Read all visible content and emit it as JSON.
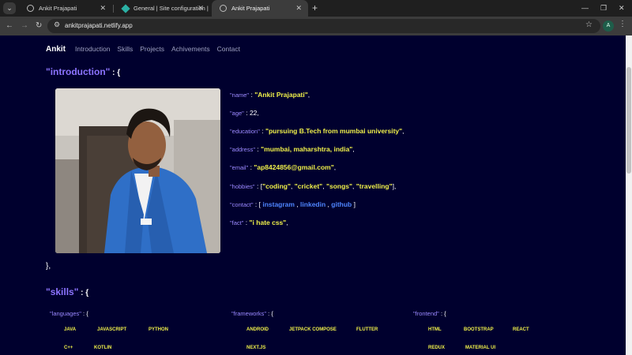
{
  "browser": {
    "tabs": [
      {
        "title": "Ankit Prajapati",
        "active": false
      },
      {
        "title": "General | Site configuration | ...",
        "active": false
      },
      {
        "title": "Ankit Prajapati",
        "active": true
      }
    ],
    "new_tab": "+",
    "url": "ankitprajapati.netlify.app",
    "profile_initial": "A"
  },
  "site": {
    "brand": "Ankit",
    "nav": [
      "Introduction",
      "Skills",
      "Projects",
      "Achivements",
      "Contact"
    ]
  },
  "intro": {
    "title": "\"introduction\"",
    "open": " : {",
    "close": "},",
    "fields": [
      {
        "key": "\"name\"",
        "value": "\"Ankit Prajapati\"",
        "type": "string"
      },
      {
        "key": "\"age\"",
        "value": "22",
        "type": "number"
      },
      {
        "key": "\"education\"",
        "value": "\"pursuing B.Tech from mumbai university\"",
        "type": "string"
      },
      {
        "key": "\"address\"",
        "value": "\"mumbai, maharshtra, india\"",
        "type": "string"
      },
      {
        "key": "\"email\"",
        "value": "\"ap8424856@gmail.com\"",
        "type": "string"
      },
      {
        "key": "\"hobbies\"",
        "value": [
          "\"coding\"",
          "\"cricket\"",
          "\"songs\"",
          "\"travelling\""
        ],
        "type": "array"
      },
      {
        "key": "\"contact\"",
        "value": [
          "instagram",
          "linkedin",
          "github"
        ],
        "type": "links"
      },
      {
        "key": "\"fact\"",
        "value": "\"i hate css\"",
        "type": "string"
      }
    ]
  },
  "skills": {
    "title": "\"skills\"",
    "open": " : {",
    "groups": [
      {
        "key": "\"languages\"",
        "items": [
          "JAVA",
          "JAVASCRIPT",
          "PYTHON",
          "C++",
          "KOTLIN"
        ]
      },
      {
        "key": "\"frameworks\"",
        "items": [
          "ANDROID",
          "JETPACK COMPOSE",
          "FLUTTER",
          "NEXT.JS"
        ]
      },
      {
        "key": "\"frontend\"",
        "items": [
          "HTML",
          "BOOTSTRAP",
          "REACT",
          "REDUX",
          "MATERIAL UI"
        ]
      }
    ]
  },
  "colors": {
    "page_bg": "#00002e",
    "key": "#9d8bff",
    "string": "#f0f04a",
    "link": "#4f86ff",
    "section_title": "#8c74ff"
  }
}
